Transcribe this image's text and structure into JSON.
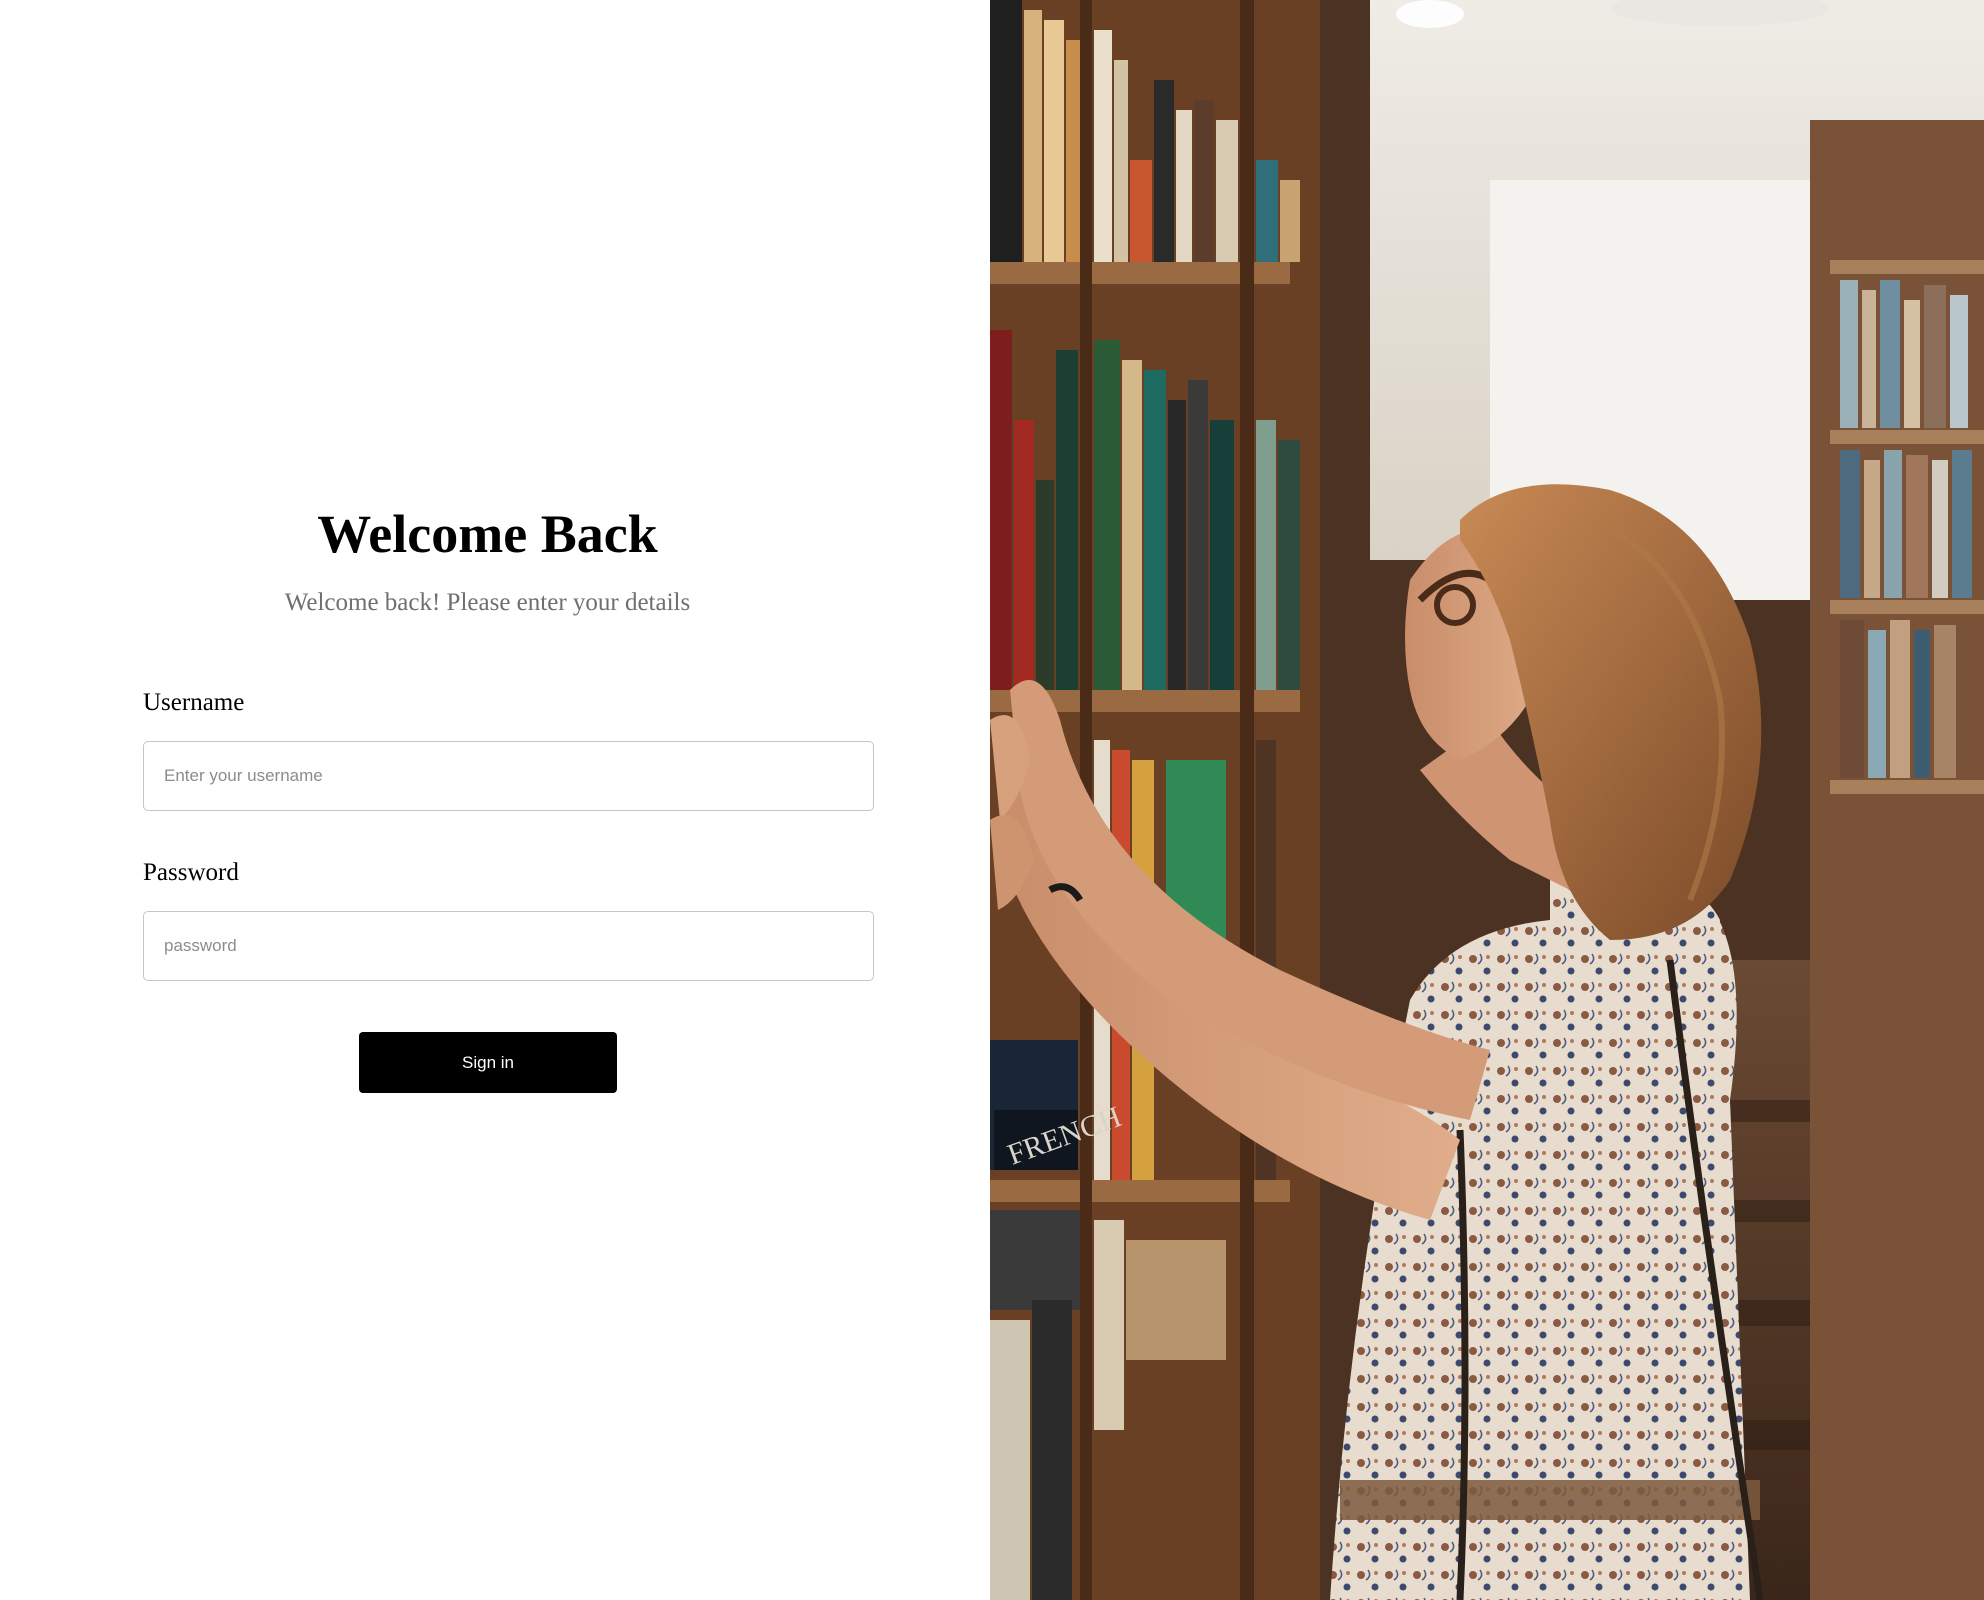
{
  "login": {
    "title": "Welcome Back",
    "subtitle": "Welcome back! Please enter your details",
    "username": {
      "label": "Username",
      "placeholder": "Enter your username",
      "value": ""
    },
    "password": {
      "label": "Password",
      "placeholder": "password",
      "value": ""
    },
    "signin_label": "Sign in"
  },
  "hero_image": {
    "subject": "library-photo",
    "book_spine_text": "FRENCH"
  },
  "colors": {
    "background": "#ffffff",
    "button": "#000000",
    "button_text": "#ffffff",
    "subtitle_text": "#6f6f6f",
    "input_border": "#c6c6c6"
  }
}
